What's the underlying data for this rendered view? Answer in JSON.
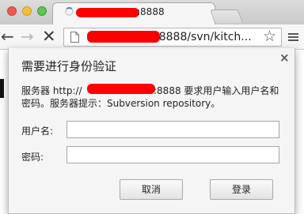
{
  "browser": {
    "tab": {
      "title_suffix": ":8888"
    },
    "address_bar": {
      "url_suffix": ":8888/svn/kitch..."
    },
    "icons": {
      "back": "arrow-left-icon",
      "forward": "arrow-right-icon",
      "stop": "stop-icon",
      "bookmark": "star-icon",
      "menu": "hamburger-menu-icon"
    }
  },
  "dialog": {
    "title": "需要进行身份验证",
    "close_glyph": "×",
    "message_prefix": "服务器 http://",
    "message_suffix": ":8888 要求用户输入用户名和",
    "message_line2": "密码。服务器提示：Subversion repository。",
    "username_label": "用户名:",
    "username_value": "",
    "password_label": "密码:",
    "password_value": "",
    "cancel_label": "取消",
    "login_label": "登录"
  }
}
